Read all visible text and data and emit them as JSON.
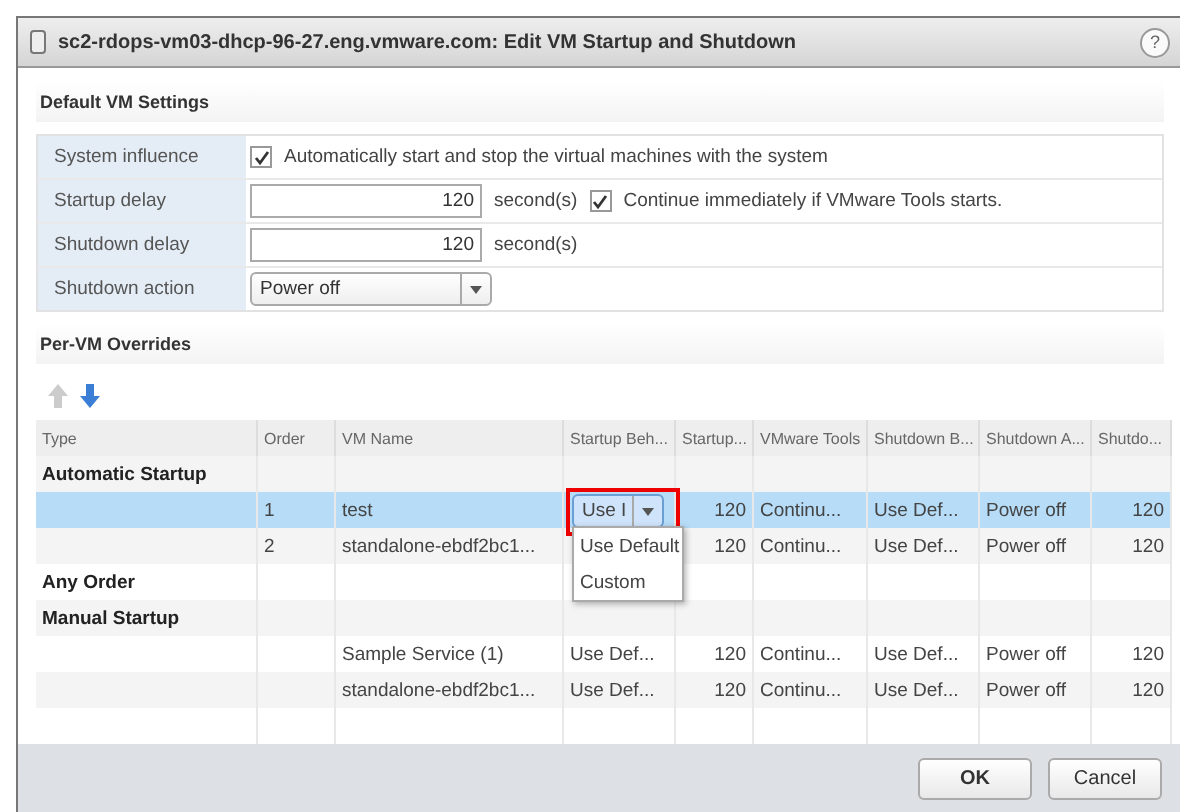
{
  "window": {
    "title": "sc2-rdops-vm03-dhcp-96-27.eng.vmware.com: Edit VM Startup and Shutdown",
    "help": "?"
  },
  "defaults": {
    "title": "Default VM Settings",
    "system_influence": {
      "label": "System influence",
      "checked": true,
      "text": "Automatically start and stop the virtual machines with the system"
    },
    "startup_delay": {
      "label": "Startup delay",
      "value": "120",
      "unit": "second(s)",
      "continue_checked": true,
      "continue_text": "Continue immediately if VMware Tools starts."
    },
    "shutdown_delay": {
      "label": "Shutdown delay",
      "value": "120",
      "unit": "second(s)"
    },
    "shutdown_action": {
      "label": "Shutdown action",
      "value": "Power off"
    }
  },
  "overrides": {
    "title": "Per-VM Overrides",
    "move_up": {
      "disabled": true
    },
    "move_down": {
      "disabled": false
    },
    "columns": [
      "Type",
      "Order",
      "VM Name",
      "Startup Beh...",
      "Startup...",
      "VMware Tools",
      "Shutdown B...",
      "Shutdown A...",
      "Shutdo..."
    ],
    "rows": [
      {
        "kind": "group",
        "label": "Automatic Startup"
      },
      {
        "kind": "vm",
        "selected": true,
        "order": "1",
        "vm_name": "test",
        "dropdown": {
          "value": "Use I",
          "open": true,
          "highlighted": true,
          "options": [
            "Use Default",
            "Custom"
          ]
        },
        "startup_delay": "120",
        "vmware_tools": "Continu...",
        "shutdown_behavior": "Use Def...",
        "shutdown_action": "Power off",
        "shutdown_delay": "120"
      },
      {
        "kind": "vm",
        "selected": false,
        "order": "2",
        "vm_name": "standalone-ebdf2bc1...",
        "startup_delay": "120",
        "vmware_tools": "Continu...",
        "shutdown_behavior": "Use Def...",
        "shutdown_action": "Power off",
        "shutdown_delay": "120"
      },
      {
        "kind": "group",
        "label": "Any Order"
      },
      {
        "kind": "group",
        "label": "Manual Startup"
      },
      {
        "kind": "vm",
        "selected": false,
        "vm_name": "Sample Service (1)",
        "startup_behavior": "Use Def...",
        "startup_delay": "120",
        "vmware_tools": "Continu...",
        "shutdown_behavior": "Use Def...",
        "shutdown_action": "Power off",
        "shutdown_delay": "120"
      },
      {
        "kind": "vm",
        "selected": false,
        "vm_name": "standalone-ebdf2bc1...",
        "startup_behavior": "Use Def...",
        "startup_delay": "120",
        "vmware_tools": "Continu...",
        "shutdown_behavior": "Use Def...",
        "shutdown_action": "Power off",
        "shutdown_delay": "120"
      },
      {
        "kind": "empty"
      }
    ]
  },
  "buttons": [
    "OK",
    "Cancel"
  ]
}
